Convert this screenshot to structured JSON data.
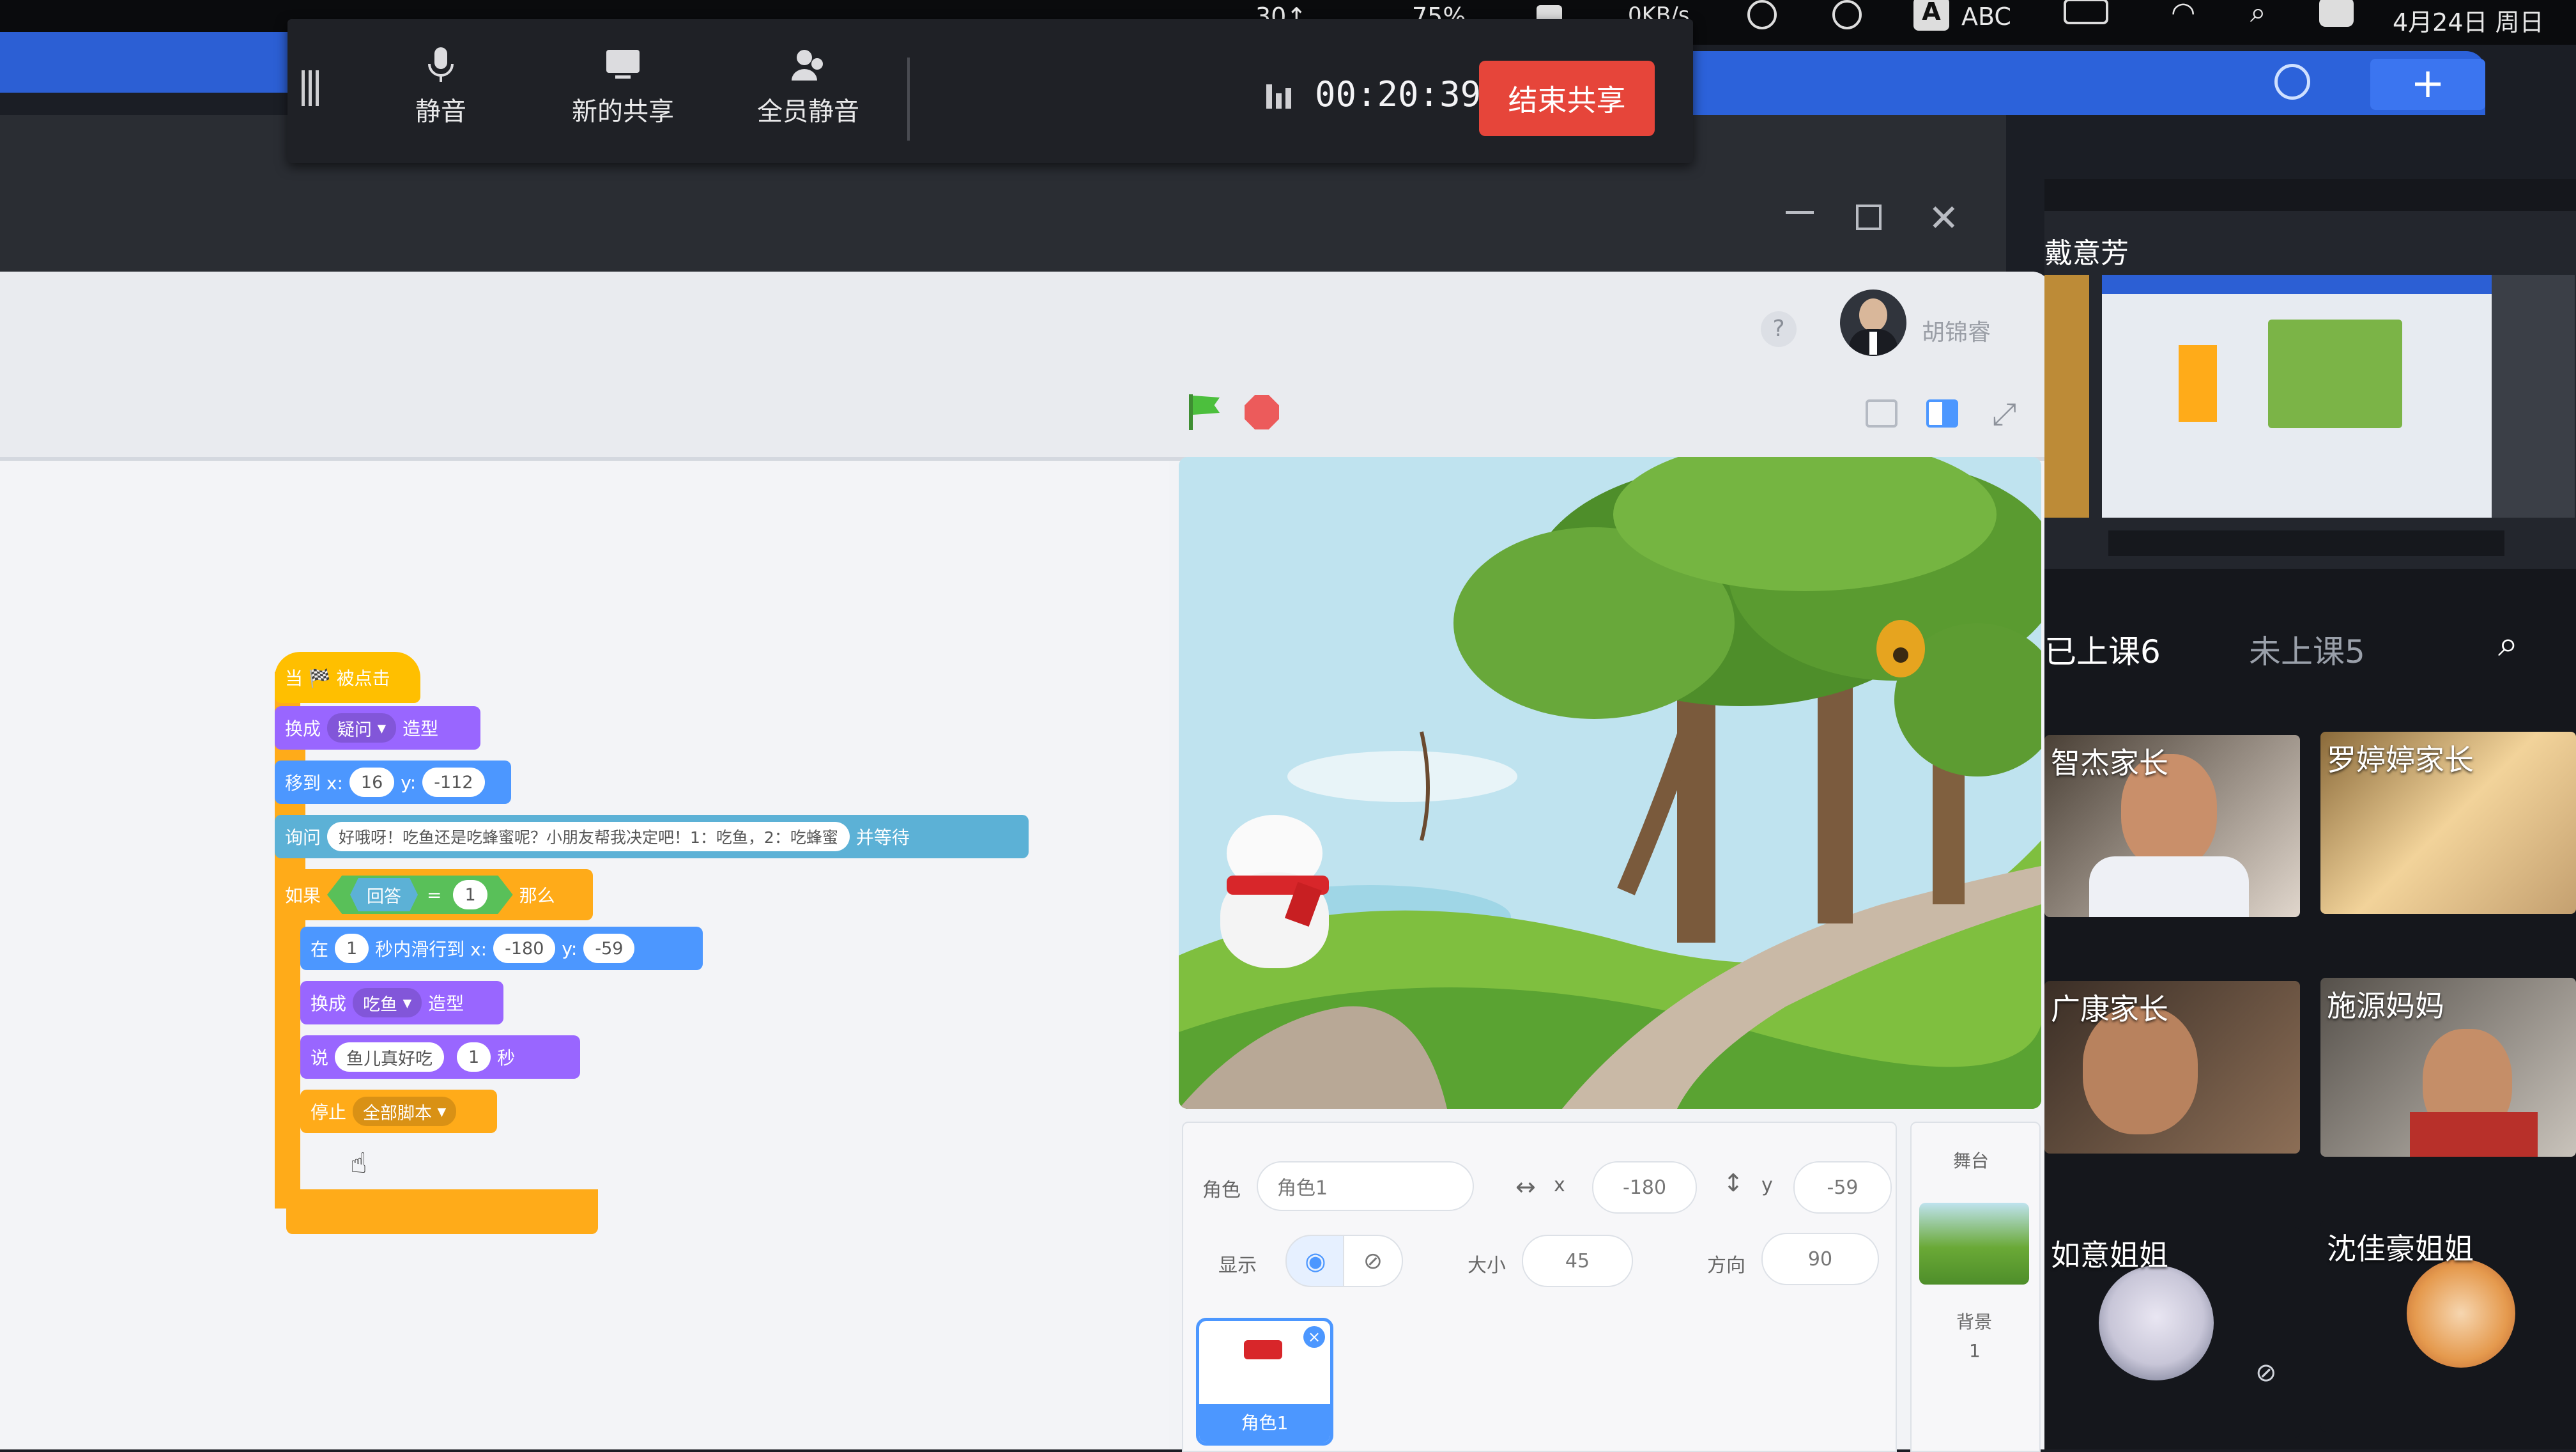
{
  "menubar": {
    "battery": "75%",
    "net_speed": "0KB/s",
    "input_method": "ABC",
    "date": "4月24日 周日",
    "items_prefix": "30↑"
  },
  "meeting_toolbar": {
    "mute_label": "静音",
    "new_share_label": "新的共享",
    "mute_all_label": "全员静音",
    "timer": "00:20:39",
    "end_share_label": "结束共享"
  },
  "scratch": {
    "user_name": "胡锦睿",
    "help_label": "?",
    "blocks": {
      "hat": "当 🏁 被点击",
      "costume1": {
        "prefix": "换成",
        "value": "疑问",
        "suffix": "造型"
      },
      "goto": {
        "prefix": "移到 x:",
        "x": "16",
        "ylabel": "y:",
        "y": "-112"
      },
      "ask": {
        "prefix": "询问",
        "text": "好哦呀！吃鱼还是吃蜂蜜呢？小朋友帮我决定吧！1：吃鱼，2：吃蜂蜜",
        "suffix": "并等待"
      },
      "if": {
        "prefix": "如果",
        "answer": "回答",
        "op": "=",
        "value": "1",
        "suffix": "那么"
      },
      "glide": {
        "prefix": "在",
        "secs": "1",
        "mid": "秒内滑行到 x:",
        "x": "-180",
        "ylabel": "y:",
        "y": "-59"
      },
      "costume2": {
        "prefix": "换成",
        "value": "吃鱼",
        "suffix": "造型"
      },
      "say": {
        "prefix": "说",
        "text": "鱼儿真好吃",
        "secs": "1",
        "suffix": "秒"
      },
      "stop": {
        "prefix": "停止",
        "value": "全部脚本"
      }
    },
    "sprite_info": {
      "sprite_label": "角色",
      "sprite_name": "角色1",
      "x_label": "x",
      "x": "-180",
      "y_label": "y",
      "y": "-59",
      "show_label": "显示",
      "size_label": "大小",
      "size": "45",
      "direction_label": "方向",
      "direction": "90"
    },
    "sprite_tile_name": "角色1",
    "stage_pane": {
      "title": "舞台",
      "backdrop_label": "背景",
      "backdrop_count": "1"
    }
  },
  "right_panel": {
    "presenter_name": "戴意芳",
    "tab_attended": "已上课6",
    "tab_not_attended": "未上课5",
    "participants": [
      {
        "name": "智杰家长"
      },
      {
        "name": "罗婷婷家长"
      },
      {
        "name": "广康家长"
      },
      {
        "name": "施源妈妈"
      },
      {
        "name": "如意姐姐"
      },
      {
        "name": "沈佳豪姐姐"
      }
    ]
  },
  "colors": {
    "end_share": "#e6453a",
    "motion": "#4c97ff",
    "looks": "#9966ff",
    "event": "#ffbf00",
    "sensing": "#5cb1d6",
    "browser_blue": "#2c5fd4"
  }
}
